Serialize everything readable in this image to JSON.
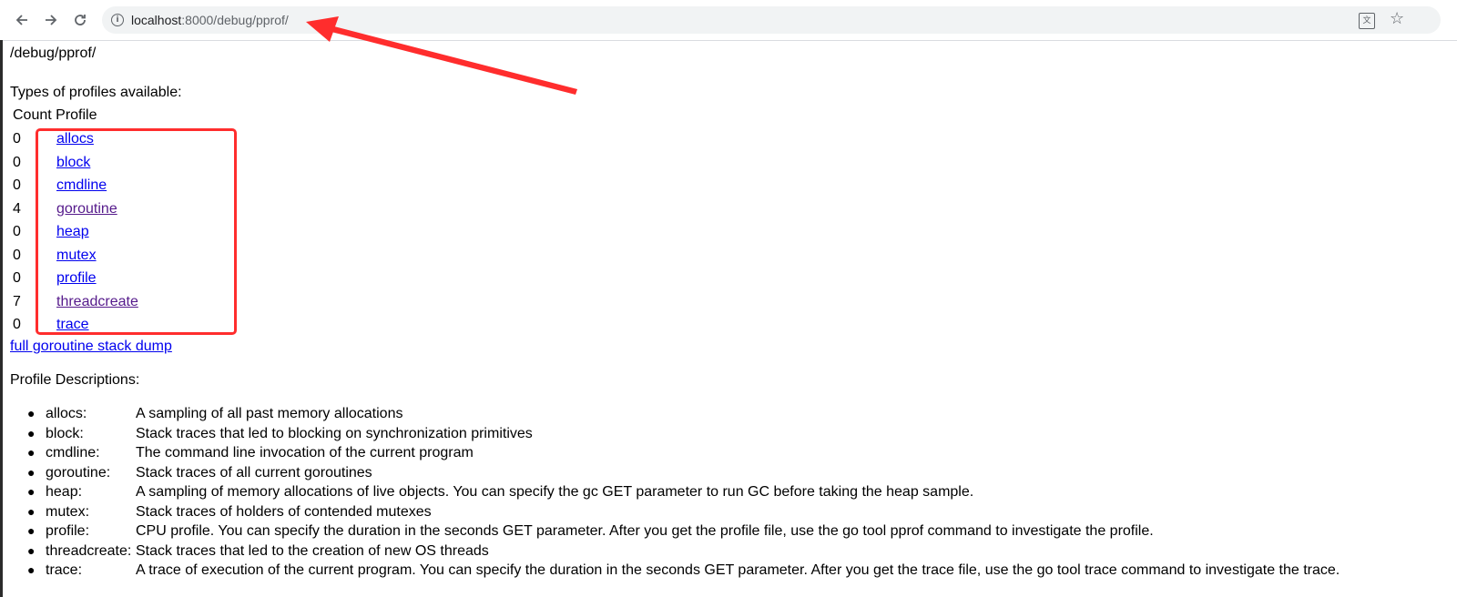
{
  "browser": {
    "url_host": "localhost",
    "url_path": ":8000/debug/pprof/",
    "back_icon": "arrow-left-icon",
    "forward_icon": "arrow-right-icon",
    "reload_icon": "reload-icon",
    "info_icon": "info-icon",
    "translate_icon": "translate-icon",
    "bookmark_icon": "star-icon"
  },
  "page": {
    "title": "/debug/pprof/",
    "types_heading": "Types of profiles available:",
    "table_headers": {
      "count": "Count",
      "profile": "Profile"
    },
    "profiles": [
      {
        "count": "0",
        "name": "allocs"
      },
      {
        "count": "0",
        "name": "block"
      },
      {
        "count": "0",
        "name": "cmdline"
      },
      {
        "count": "4",
        "name": "goroutine"
      },
      {
        "count": "0",
        "name": "heap"
      },
      {
        "count": "0",
        "name": "mutex"
      },
      {
        "count": "0",
        "name": "profile"
      },
      {
        "count": "7",
        "name": "threadcreate"
      },
      {
        "count": "0",
        "name": "trace"
      }
    ],
    "full_dump_link": "full goroutine stack dump",
    "descriptions_heading": "Profile Descriptions:",
    "descriptions": [
      {
        "name": "allocs:",
        "text": "A sampling of all past memory allocations"
      },
      {
        "name": "block:",
        "text": "Stack traces that led to blocking on synchronization primitives"
      },
      {
        "name": "cmdline:",
        "text": "The command line invocation of the current program"
      },
      {
        "name": "goroutine:",
        "text": "Stack traces of all current goroutines"
      },
      {
        "name": "heap:",
        "text": "A sampling of memory allocations of live objects. You can specify the gc GET parameter to run GC before taking the heap sample."
      },
      {
        "name": "mutex:",
        "text": "Stack traces of holders of contended mutexes"
      },
      {
        "name": "profile:",
        "text": "CPU profile. You can specify the duration in the seconds GET parameter. After you get the profile file, use the go tool pprof command to investigate the profile."
      },
      {
        "name": "threadcreate:",
        "text": "Stack traces that led to the creation of new OS threads"
      },
      {
        "name": "trace:",
        "text": "A trace of execution of the current program. You can specify the duration in the seconds GET parameter. After you get the trace file, use the go tool trace command to investigate the trace."
      }
    ]
  },
  "annotations": {
    "color": "#ff2d2d"
  },
  "colors": {
    "link": "#0000ee",
    "visited_link": "#551a8b"
  }
}
